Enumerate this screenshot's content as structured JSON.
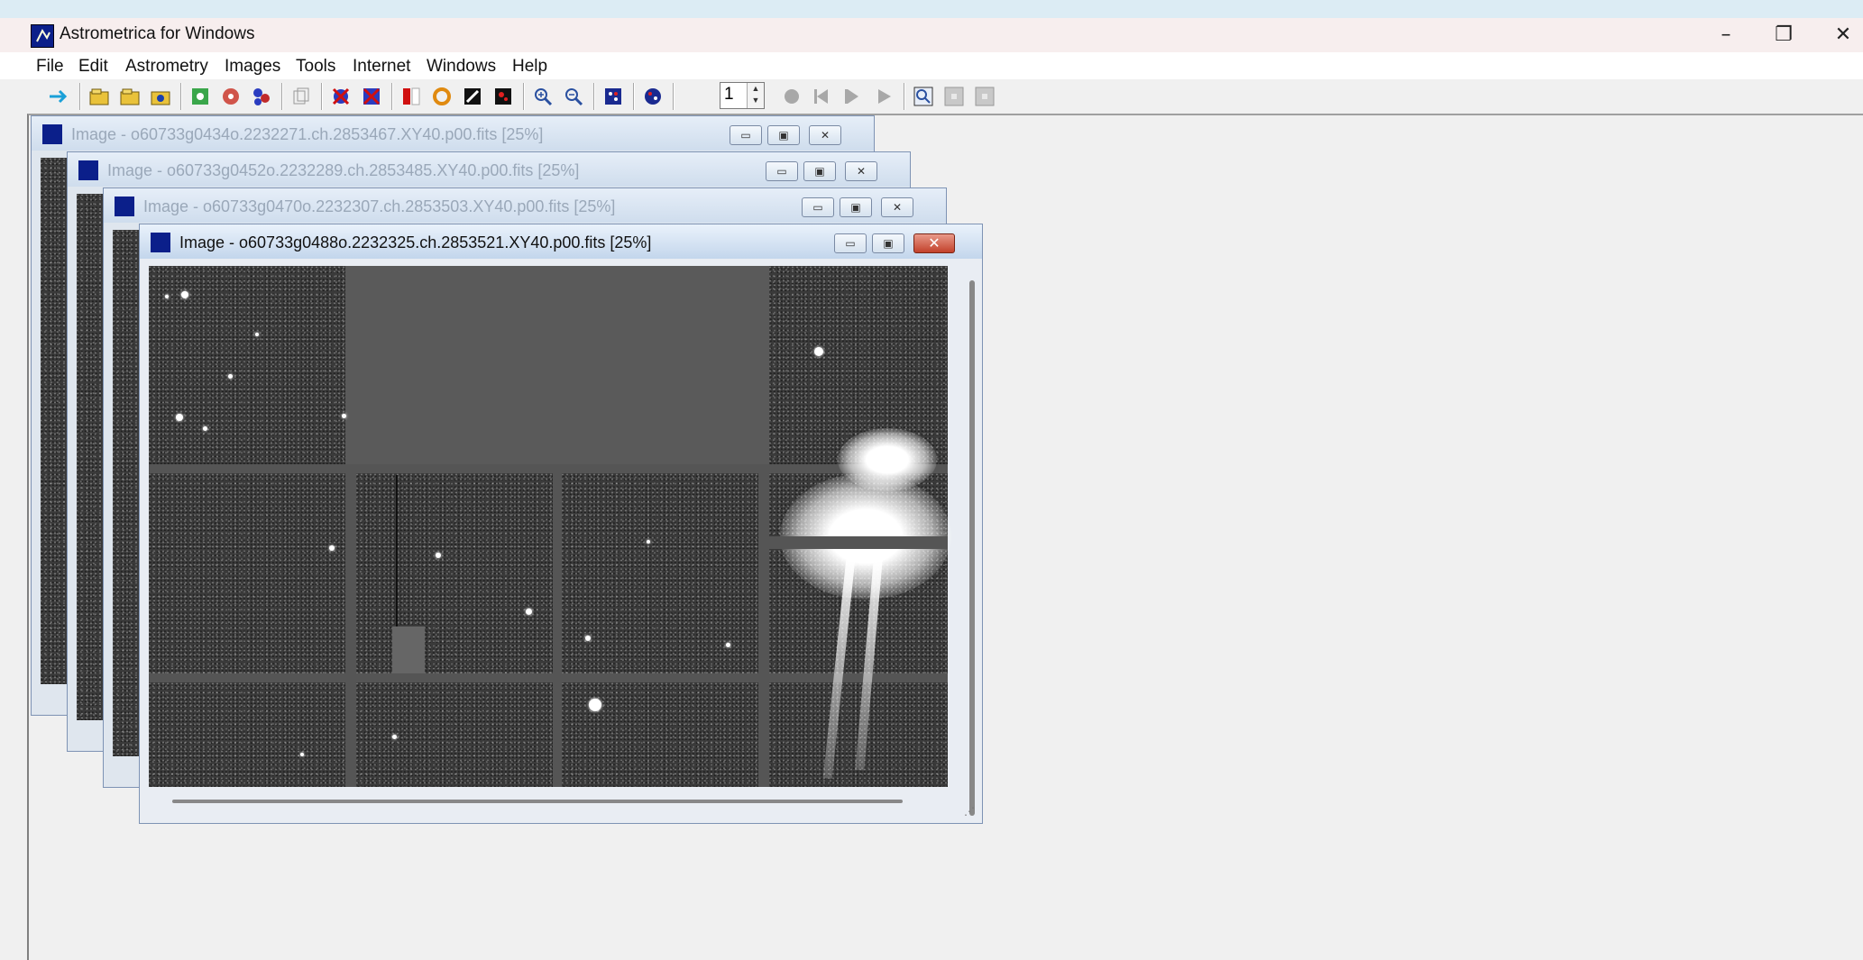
{
  "app": {
    "title": "Astrometrica for Windows"
  },
  "window_controls": {
    "minimize": "–",
    "restore": "❐",
    "close": "✕"
  },
  "menu": [
    "File",
    "Edit",
    "Astrometry",
    "Images",
    "Tools",
    "Internet",
    "Windows",
    "Help"
  ],
  "toolbar": {
    "frame_value": "1",
    "icons": [
      "connect-icon",
      "open-image-icon",
      "open-folder-icon",
      "open-catalog-icon",
      "data-reduction-icon",
      "settings-icon",
      "known-objects-icon",
      "copy-icon",
      "delete-icon",
      "delete-all-icon",
      "blink-icon",
      "color-icon",
      "edit-icon",
      "contrast-icon",
      "zoom-in-icon",
      "zoom-out-icon",
      "dice-icon",
      "globe-icon",
      "record-icon",
      "prev-frame-icon",
      "next-frame-icon",
      "play-icon",
      "magnify-icon",
      "box-icon",
      "box2-icon"
    ]
  },
  "child_windows": [
    {
      "title": "Image - o60733g0434o.2232271.ch.2853467.XY40.p00.fits [25%]",
      "active": false
    },
    {
      "title": "Image - o60733g0452o.2232289.ch.2853485.XY40.p00.fits [25%]",
      "active": false
    },
    {
      "title": "Image - o60733g0470o.2232307.ch.2853503.XY40.p00.fits [25%]",
      "active": false
    },
    {
      "title": "Image - o60733g0488o.2232325.ch.2853521.XY40.p00.fits [25%]",
      "active": true
    }
  ],
  "child_buttons": {
    "minimize": "▭",
    "maximize": "▣",
    "close": "✕"
  },
  "colors": {
    "accent_dark": "#0b1f8a",
    "close_red": "#c2412b",
    "background_image": "#3a3a3a"
  }
}
